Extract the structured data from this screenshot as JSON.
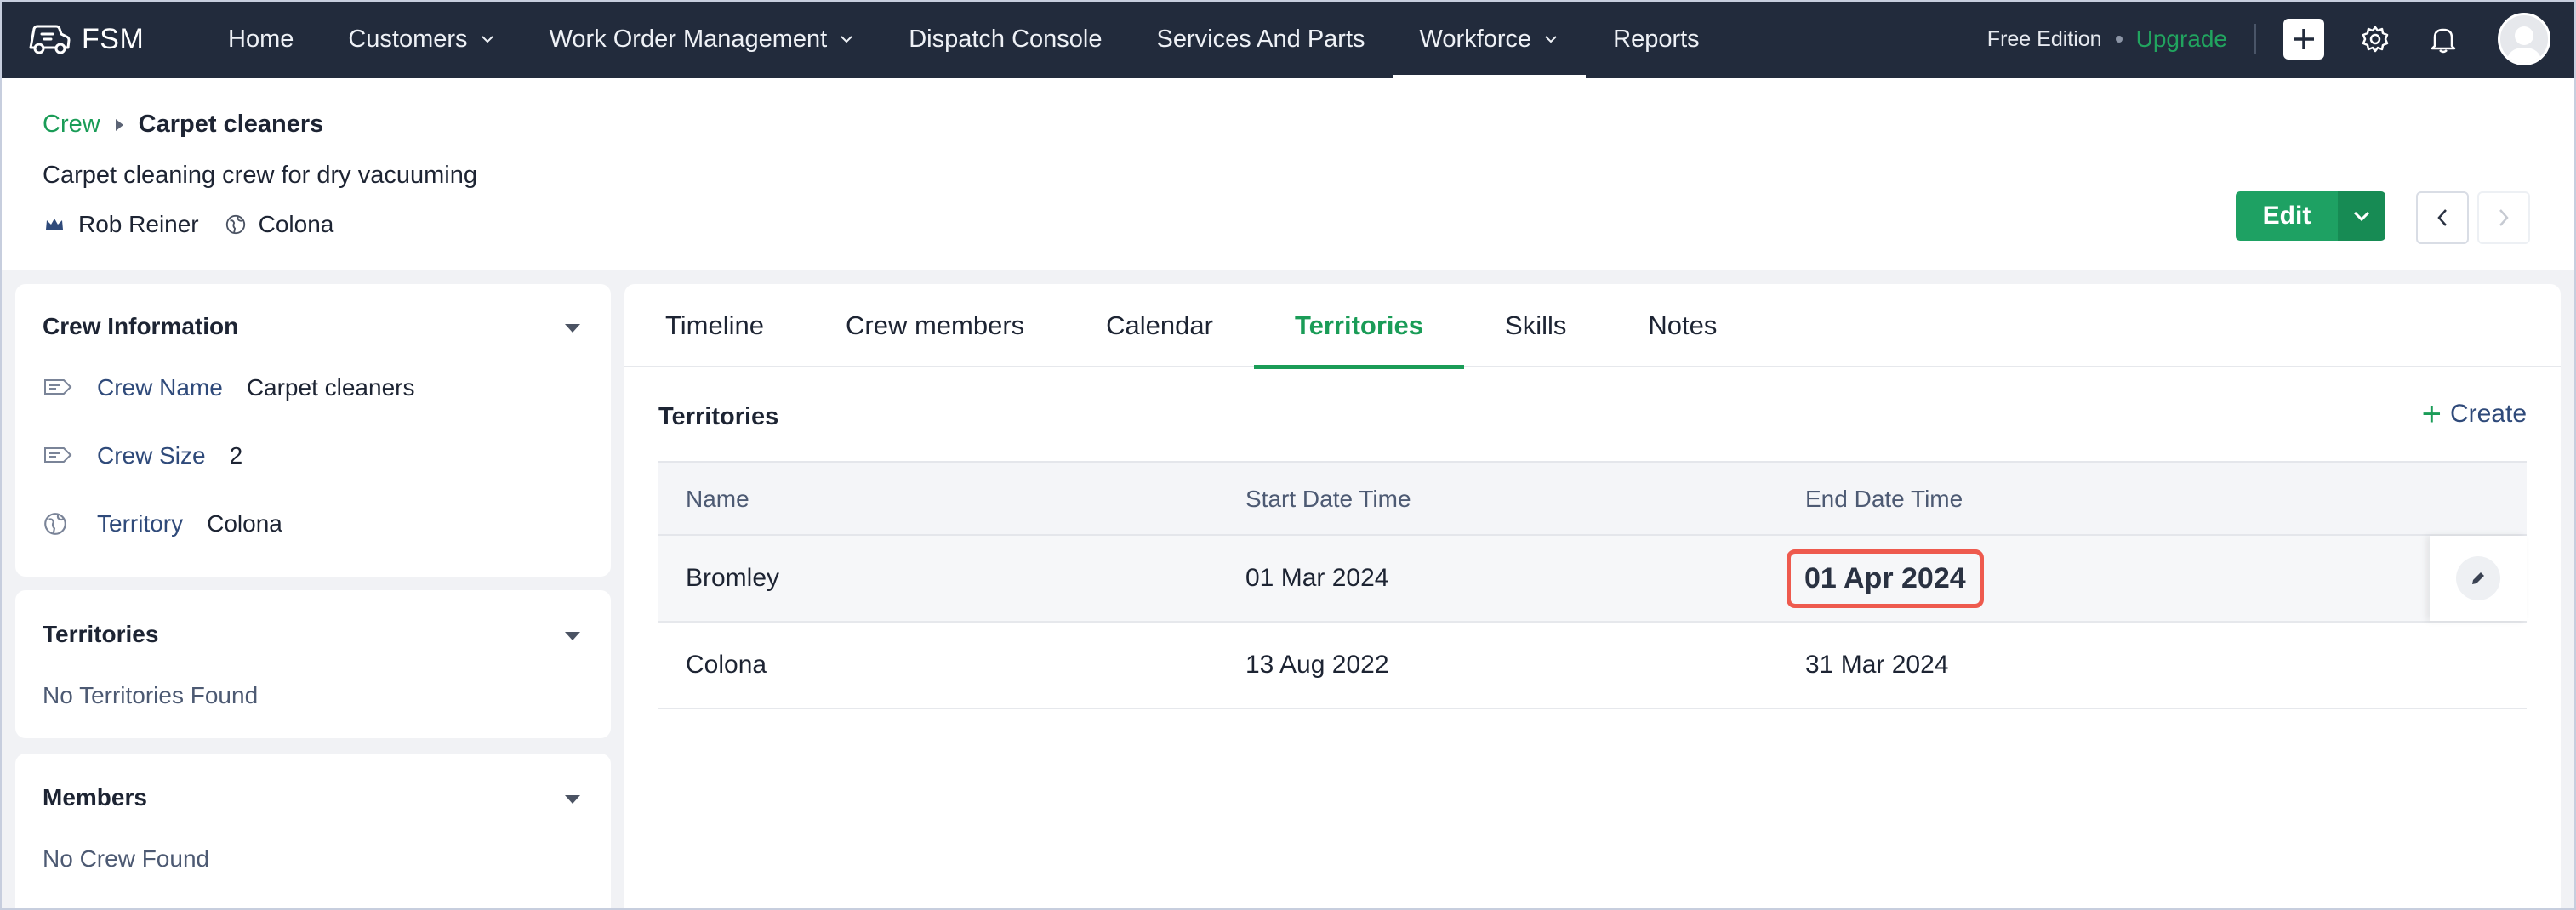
{
  "nav": {
    "brand": "FSM",
    "items": [
      {
        "label": "Home",
        "dropdown": false,
        "active": false
      },
      {
        "label": "Customers",
        "dropdown": true,
        "active": false
      },
      {
        "label": "Work Order Management",
        "dropdown": true,
        "active": false
      },
      {
        "label": "Dispatch Console",
        "dropdown": false,
        "active": false
      },
      {
        "label": "Services And Parts",
        "dropdown": false,
        "active": false
      },
      {
        "label": "Workforce",
        "dropdown": true,
        "active": true
      },
      {
        "label": "Reports",
        "dropdown": false,
        "active": false
      }
    ],
    "edition": "Free Edition",
    "upgrade": "Upgrade"
  },
  "header": {
    "breadcrumb_parent": "Crew",
    "breadcrumb_current": "Carpet cleaners",
    "description": "Carpet cleaning crew for dry vacuuming",
    "leader": "Rob Reiner",
    "territory": "Colona",
    "edit_label": "Edit"
  },
  "left": {
    "crew_info": {
      "title": "Crew Information",
      "rows": [
        {
          "label": "Crew Name",
          "value": "Carpet cleaners"
        },
        {
          "label": "Crew Size",
          "value": "2"
        },
        {
          "label": "Territory",
          "value": "Colona"
        }
      ]
    },
    "territories": {
      "title": "Territories",
      "empty": "No Territories Found"
    },
    "members": {
      "title": "Members",
      "empty": "No Crew Found"
    }
  },
  "main": {
    "tabs": [
      "Timeline",
      "Crew members",
      "Calendar",
      "Territories",
      "Skills",
      "Notes"
    ],
    "active_tab": "Territories",
    "section_title": "Territories",
    "create_label": "Create",
    "columns": [
      "Name",
      "Start Date Time",
      "End Date Time"
    ],
    "rows": [
      {
        "name": "Bromley",
        "start": "01 Mar 2024",
        "end": "01 Apr 2024"
      },
      {
        "name": "Colona",
        "start": "13 Aug 2022",
        "end": "31 Mar 2024"
      }
    ]
  },
  "colors": {
    "nav_bg": "#222b3c",
    "accent_green": "#1a9c57",
    "highlight_red": "#ee5a4e"
  }
}
